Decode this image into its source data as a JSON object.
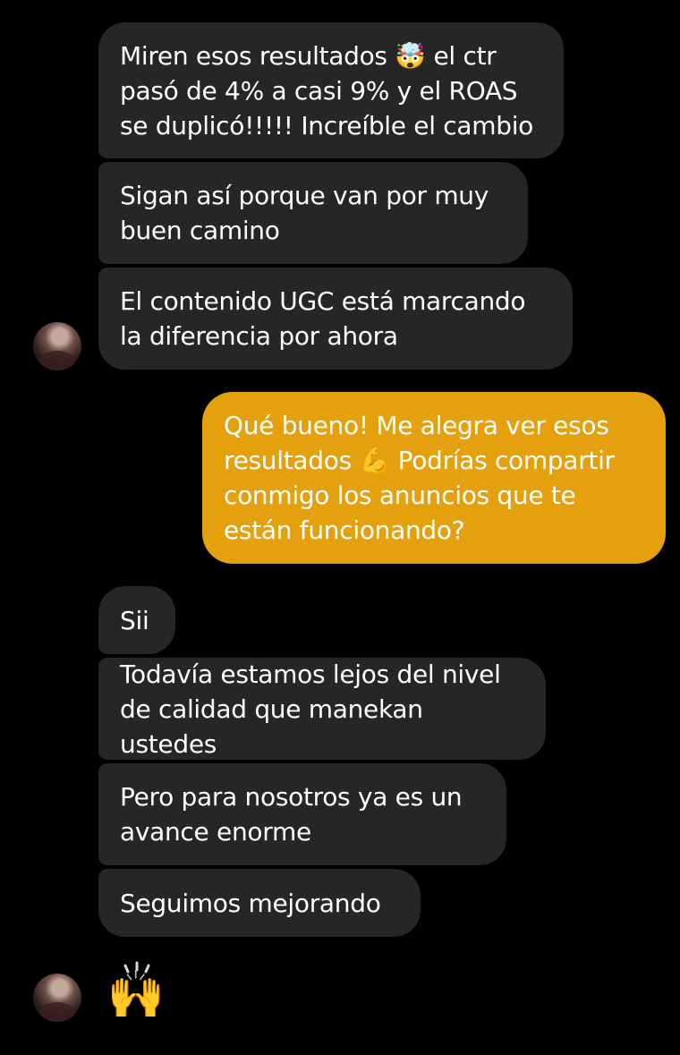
{
  "conversation": {
    "messages": [
      {
        "id": "m1",
        "sender": "contact",
        "text": "Miren esos resultados 🤯 el ctr\npasó de 4% a casi 9% y el ROAS\nse duplicó!!!!! Increíble el cambio"
      },
      {
        "id": "m2",
        "sender": "contact",
        "text": "Sigan así porque van por muy\nbuen camino"
      },
      {
        "id": "m3",
        "sender": "contact",
        "text": "El contenido UGC está marcando\nla diferencia por ahora"
      },
      {
        "id": "m4",
        "sender": "me",
        "text": "Qué bueno! Me alegra ver esos\nresultados 💪 Podrías compartir\nconmigo los anuncios que te\nestán funcionando?"
      },
      {
        "id": "m5",
        "sender": "contact",
        "text": "Sii"
      },
      {
        "id": "m6",
        "sender": "contact",
        "text": "Todavía estamos lejos del nivel\nde calidad que manekan ustedes"
      },
      {
        "id": "m7",
        "sender": "contact",
        "text": "Pero para nosotros ya es un\navance enorme"
      },
      {
        "id": "m8",
        "sender": "contact",
        "text": "Seguimos mejorando"
      },
      {
        "id": "m9",
        "sender": "contact",
        "text": "🙌"
      }
    ]
  },
  "colors": {
    "background": "#000000",
    "incoming_bubble": "#262626",
    "outgoing_bubble": "#e5a00e",
    "text": "#ffffff"
  },
  "icons": {
    "contact_avatar": "avatar",
    "reaction_emoji": "raising-hands-emoji"
  }
}
